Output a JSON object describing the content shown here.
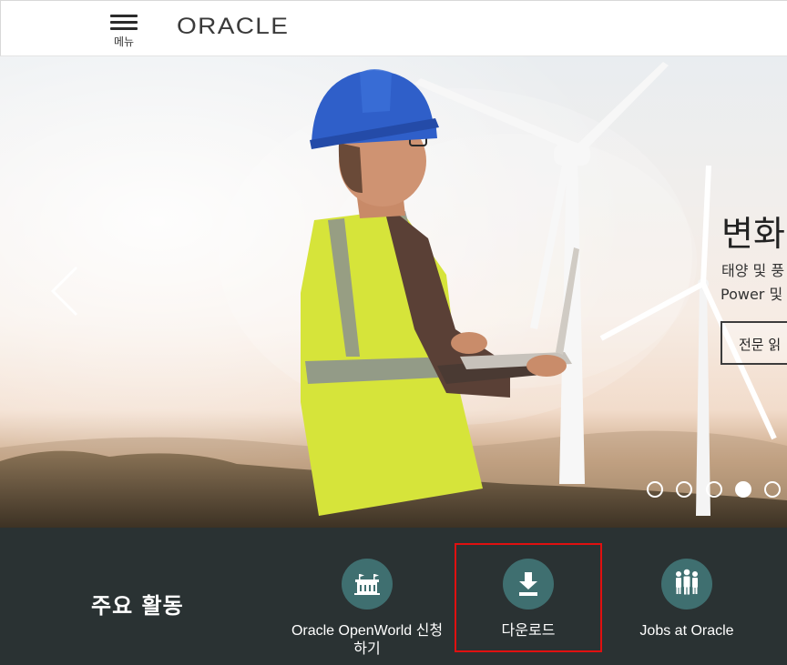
{
  "header": {
    "menu_label": "메뉴",
    "logo_text": "ORACLE"
  },
  "hero": {
    "headline": "변화",
    "subtext_line1": "태양 및 풍",
    "subtext_line2": "Power 및",
    "cta_label": "전문 읽",
    "slide_count": 5,
    "active_slide": 4
  },
  "bottom": {
    "title": "주요 활동",
    "items": [
      {
        "label": "Oracle OpenWorld 신청하기",
        "icon": "building-icon"
      },
      {
        "label": "다운로드",
        "icon": "download-icon"
      },
      {
        "label": "Jobs at Oracle",
        "icon": "people-icon"
      }
    ]
  },
  "colors": {
    "bottom_bg": "#2a3233",
    "icon_circle": "#3f6f70",
    "highlight": "#e01010"
  }
}
